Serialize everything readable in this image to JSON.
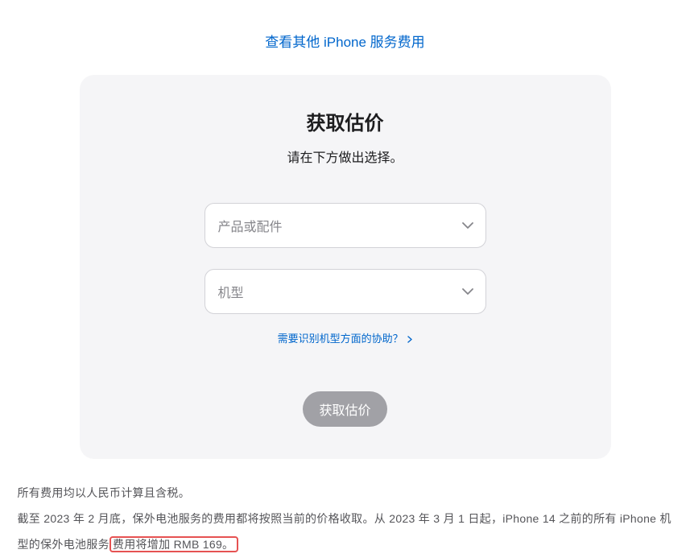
{
  "topLink": {
    "label": "查看其他 iPhone 服务费用"
  },
  "card": {
    "title": "获取估价",
    "subtitle": "请在下方做出选择。",
    "select1": {
      "placeholder": "产品或配件"
    },
    "select2": {
      "placeholder": "机型"
    },
    "helpLink": {
      "label": "需要识别机型方面的协助？"
    },
    "submit": {
      "label": "获取估价"
    }
  },
  "notes": {
    "line1": "所有费用均以人民币计算且含税。",
    "line2_pre": "截至 2023 年 2 月底，保外电池服务的费用都将按照当前的价格收取。从 2023 年 3 月 1 日起，iPhone 14 之前的所有 iPhone 机型的保外电池服务",
    "line2_highlight": "费用将增加 RMB 169。"
  }
}
